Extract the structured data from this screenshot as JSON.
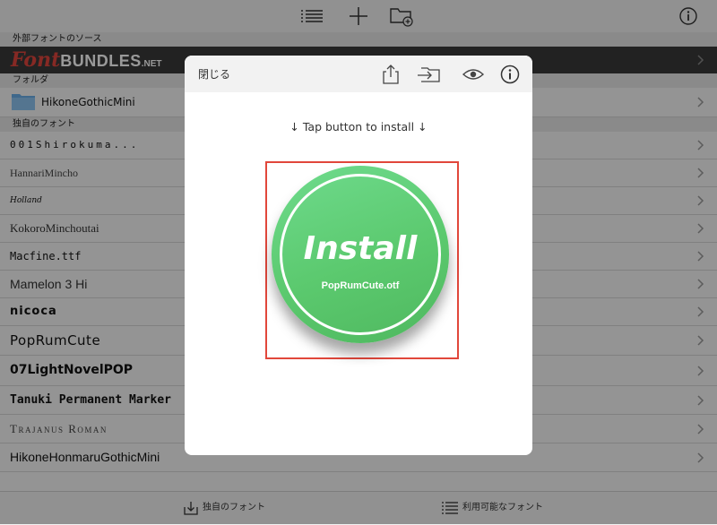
{
  "sections": {
    "external": "外部フォントのソース",
    "folder": "フォルダ",
    "own": "独自のフォント"
  },
  "fontbundles": {
    "logo_font": "Font",
    "logo_bundles": "BUNDLES",
    "logo_net": ".NET"
  },
  "folders": [
    {
      "label": "HikoneGothicMini"
    }
  ],
  "fonts": [
    {
      "label": "001Shirokuma..."
    },
    {
      "label": "HannariMincho"
    },
    {
      "label": "Holland"
    },
    {
      "label": "KokoroMinchoutai"
    },
    {
      "label": "Macfine.ttf"
    },
    {
      "label": "Mamelon 3 Hi"
    },
    {
      "label": "nicoca"
    },
    {
      "label": "PopRumCute"
    },
    {
      "label": "07LightNovelPOP"
    },
    {
      "label": "Tanuki Permanent Marker"
    },
    {
      "label": "Trajanus Roman"
    },
    {
      "label": "HikoneHonmaruGothicMini"
    }
  ],
  "bottom_tabs": {
    "own_fonts": "独自のフォント",
    "available_fonts": "利用可能なフォント"
  },
  "modal": {
    "close_label": "閉じる",
    "hint": "↓ Tap button to install ↓",
    "install_label": "Install",
    "file_name": "PopRumCute.otf"
  },
  "colors": {
    "accent_green": "#5bc96e",
    "frame_red": "#e1473b",
    "fontbundles_red": "#e0453c"
  }
}
